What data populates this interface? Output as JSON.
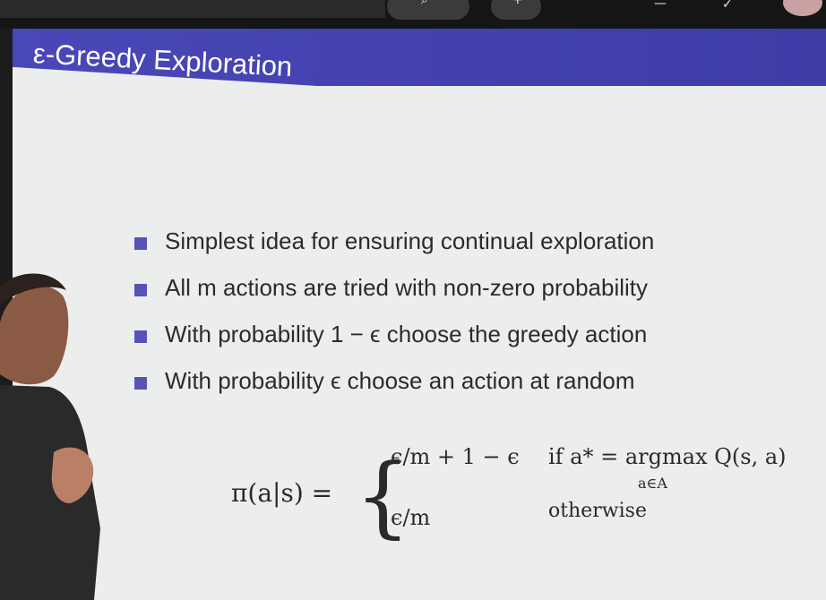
{
  "toolbar": {
    "icons": [
      "search-icon",
      "plus-icon",
      "minus-icon",
      "check-icon",
      "avatar"
    ]
  },
  "slide": {
    "title": "ε-Greedy Exploration",
    "bullets": [
      "Simplest idea for ensuring continual exploration",
      "All m actions are tried with non-zero probability",
      "With probability 1 − ϵ choose the greedy action",
      "With probability ϵ choose an action at random"
    ],
    "equation": {
      "lhs": "π(a|s) =",
      "case1": "ϵ/m + 1 − ϵ",
      "cond1": "if a* = argmax Q(s, a)",
      "subscript": "a∈A",
      "case2": "ϵ/m",
      "cond2": "otherwise"
    }
  },
  "colors": {
    "banner": "#4a47b8",
    "bullet_marker": "#5753b8",
    "slide_bg": "#eceeee",
    "text": "#2b2b2b"
  }
}
